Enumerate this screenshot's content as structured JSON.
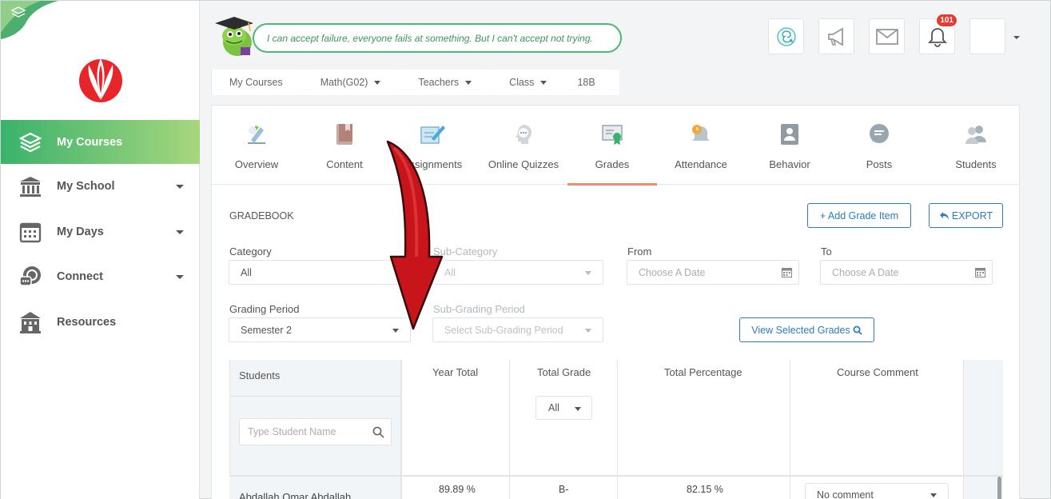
{
  "sidebar": {
    "items": [
      {
        "label": "My Courses",
        "icon": "layers-icon",
        "active": true,
        "has_caret": false
      },
      {
        "label": "My School",
        "icon": "school-icon",
        "active": false,
        "has_caret": true
      },
      {
        "label": "My Days",
        "icon": "calendar-icon",
        "active": false,
        "has_caret": true
      },
      {
        "label": "Connect",
        "icon": "connect-icon",
        "active": false,
        "has_caret": true
      },
      {
        "label": "Resources",
        "icon": "building-icon",
        "active": false,
        "has_caret": false
      }
    ]
  },
  "header": {
    "quote": "I can accept failure, everyone fails at something. But I can't accept not trying.",
    "notification_count": "101"
  },
  "breadcrumb": {
    "items": [
      "My Courses",
      "Math(G02)",
      "Teachers",
      "Class",
      "18B"
    ]
  },
  "tabs": [
    {
      "label": "Overview",
      "icon": "overview-icon"
    },
    {
      "label": "Content",
      "icon": "book-icon"
    },
    {
      "label": "Assignments",
      "icon": "assignment-icon"
    },
    {
      "label": "Online Quizzes",
      "icon": "quiz-icon"
    },
    {
      "label": "Grades",
      "icon": "grades-icon",
      "active": true
    },
    {
      "label": "Attendance",
      "icon": "bell-icon"
    },
    {
      "label": "Behavior",
      "icon": "person-icon"
    },
    {
      "label": "Posts",
      "icon": "chat-icon"
    },
    {
      "label": "Students",
      "icon": "students-icon"
    }
  ],
  "gradebook": {
    "title": "GRADEBOOK",
    "add_label": "+ Add Grade Item",
    "export_label": "EXPORT",
    "view_label": "View Selected Grades",
    "filters": {
      "category_label": "Category",
      "category_value": "All",
      "subcategory_label": "Sub-Category",
      "subcategory_value": "All",
      "from_label": "From",
      "from_placeholder": "Choose A Date",
      "to_label": "To",
      "to_placeholder": "Choose A Date",
      "grading_period_label": "Grading Period",
      "grading_period_value": "Semester 2",
      "sub_grading_label": "Sub-Grading Period",
      "sub_grading_placeholder": "Select Sub-Grading Period"
    }
  },
  "table": {
    "headers": {
      "students": "Students",
      "year_total": "Year Total",
      "total_grade": "Total Grade",
      "total_percentage": "Total Percentage",
      "course_comment": "Course Comment"
    },
    "student_search_placeholder": "Type Student Name",
    "grade_filter": "All",
    "rows": [
      {
        "name": "Abdallah Omar Abdallah",
        "year_total": "89.89 %",
        "total_grade": "B-",
        "total_percentage": "82.15 %",
        "comment": "No comment"
      }
    ]
  },
  "colors": {
    "accent_green": "#3ab26b",
    "accent_blue": "#2b7dbc",
    "active_tab": "#ef8e6e",
    "badge_red": "#e8392f"
  }
}
